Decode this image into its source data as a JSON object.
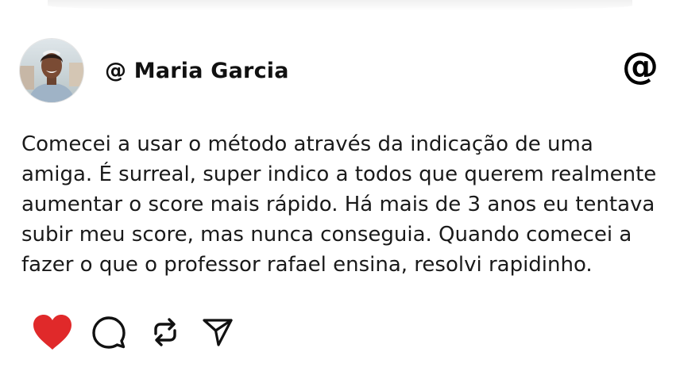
{
  "post": {
    "username": "@ Maria Garcia",
    "header_icon": "@",
    "text": "Comecei a usar o método através da indicação de uma amiga. É surreal, super indico a todos que querem realmente aumentar o score mais rápido. Há mais de 3 anos eu tentava subir meu score, mas nunca conseguia. Quando comecei a fazer o que o professor rafael ensina, resolvi rapidinho."
  },
  "actions": {
    "like_icon": "heart-icon",
    "comment_icon": "comment-bubble-icon",
    "repost_icon": "repost-icon",
    "share_icon": "send-icon",
    "like_color": "#e0292a"
  },
  "colors": {
    "background": "#ffffff",
    "text": "#1a1a1a",
    "icon": "#111111"
  }
}
